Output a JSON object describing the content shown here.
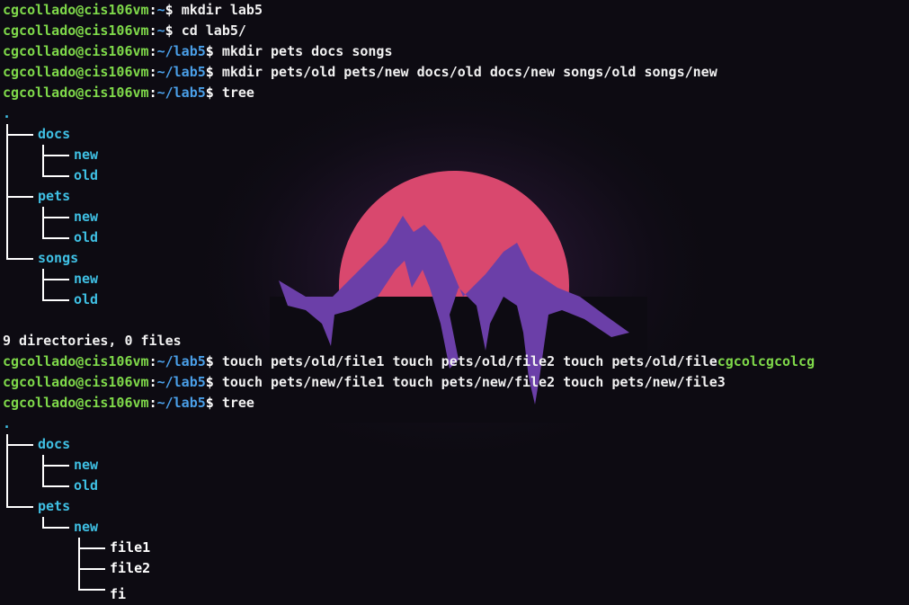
{
  "terminal": {
    "user_host": "cgcollado@cis106vm",
    "colors": {
      "prompt": "#7fd94a",
      "path": "#4a9fe8",
      "dir": "#3fc0e4",
      "file": "#ffffff",
      "text": "#f2f2f2",
      "background": "#0d0b12"
    },
    "lines": [
      {
        "type": "prompt",
        "path": "~",
        "cmd": "mkdir lab5"
      },
      {
        "type": "prompt",
        "path": "~",
        "cmd": "cd lab5/"
      },
      {
        "type": "prompt",
        "path": "~/lab5",
        "cmd": "mkdir pets docs songs"
      },
      {
        "type": "prompt",
        "path": "~/lab5",
        "cmd": "mkdir pets/old pets/new docs/old docs/new songs/old songs/new"
      },
      {
        "type": "prompt",
        "path": "~/lab5",
        "cmd": "tree"
      },
      {
        "type": "dot",
        "text": "."
      },
      {
        "type": "tree",
        "depth": 0,
        "name": "docs",
        "kind": "dir"
      },
      {
        "type": "tree",
        "depth": 1,
        "name": "new",
        "kind": "dir"
      },
      {
        "type": "tree",
        "depth": 1,
        "name": "old",
        "kind": "dir"
      },
      {
        "type": "tree",
        "depth": 0,
        "name": "pets",
        "kind": "dir"
      },
      {
        "type": "tree",
        "depth": 1,
        "name": "new",
        "kind": "dir"
      },
      {
        "type": "tree",
        "depth": 1,
        "name": "old",
        "kind": "dir"
      },
      {
        "type": "tree",
        "depth": 0,
        "name": "songs",
        "kind": "dir"
      },
      {
        "type": "tree",
        "depth": 1,
        "name": "new",
        "kind": "dir"
      },
      {
        "type": "tree",
        "depth": 1,
        "name": "old",
        "kind": "dir"
      },
      {
        "type": "blank"
      },
      {
        "type": "text",
        "text": "9 directories, 0 files"
      },
      {
        "type": "prompt",
        "path": "~/lab5",
        "cmd": "touch pets/old/file1 touch pets/old/file2 touch pets/old/file",
        "tail": "cgcolcgcolcg"
      },
      {
        "type": "prompt",
        "path": "~/lab5",
        "cmd": "touch pets/new/file1 touch pets/new/file2 touch pets/new/file3"
      },
      {
        "type": "prompt",
        "path": "~/lab5",
        "cmd": "tree"
      },
      {
        "type": "dot",
        "text": "."
      },
      {
        "type": "tree",
        "depth": 0,
        "name": "docs",
        "kind": "dir"
      },
      {
        "type": "tree",
        "depth": 1,
        "name": "new",
        "kind": "dir"
      },
      {
        "type": "tree",
        "depth": 1,
        "name": "old",
        "kind": "dir"
      },
      {
        "type": "tree",
        "depth": 0,
        "name": "pets",
        "kind": "dir"
      },
      {
        "type": "tree",
        "depth": 1,
        "name": "new",
        "kind": "dir"
      },
      {
        "type": "tree",
        "depth": 2,
        "name": "file1",
        "kind": "file"
      },
      {
        "type": "tree",
        "depth": 2,
        "name": "file2",
        "kind": "file"
      },
      {
        "type": "tree",
        "depth": 2,
        "name": "fi",
        "kind": "file",
        "clipped": true
      }
    ]
  },
  "wallpaper": {
    "subject": "mountain-sunset",
    "sun_color": "#d9486e",
    "mountain_color": "#6b3fa8"
  }
}
